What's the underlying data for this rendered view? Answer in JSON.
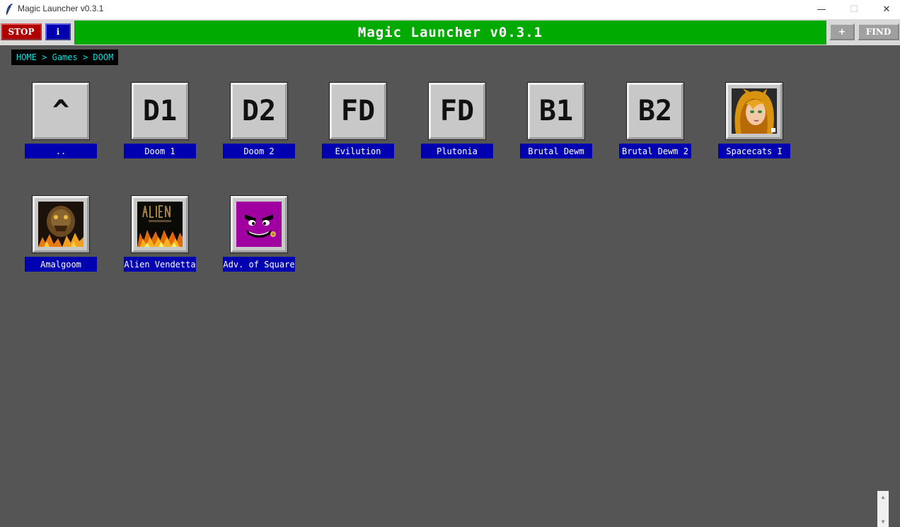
{
  "window": {
    "title": "Magic Launcher v0.3.1",
    "minimize_glyph": "—",
    "maximize_glyph": "☐",
    "close_glyph": "✕"
  },
  "toolbar": {
    "stop_label": "STOP",
    "info_label": "i",
    "banner_title": "Magic Launcher v0.3.1",
    "add_label": "+",
    "find_label": "FIND"
  },
  "breadcrumb": {
    "parts": [
      "HOME",
      "Games",
      "DOOM"
    ],
    "separator": " > "
  },
  "items": [
    {
      "icon": "^",
      "label": ".."
    },
    {
      "icon": "D1",
      "label": "Doom 1"
    },
    {
      "icon": "D2",
      "label": "Doom 2"
    },
    {
      "icon": "FD",
      "label": "Evilution"
    },
    {
      "icon": "FD",
      "label": "Plutonia"
    },
    {
      "icon": "B1",
      "label": "Brutal Dewm"
    },
    {
      "icon": "B2",
      "label": "Brutal Dewm 2"
    },
    {
      "icon": "spacecats-thumbnail",
      "label": "Spacecats I"
    },
    {
      "icon": "amalgoom-thumbnail",
      "label": "Amalgoom"
    },
    {
      "icon": "alien-vendetta-thumbnail",
      "label": "Alien Vendetta"
    },
    {
      "icon": "adv-of-square-thumbnail",
      "label": "Adv. of Square"
    }
  ],
  "colors": {
    "background": "#555555",
    "banner": "#00aa00",
    "stop": "#b00000",
    "info": "#0000b0",
    "label_bg": "#0000b0",
    "breadcrumb_text": "#00e0e0"
  }
}
